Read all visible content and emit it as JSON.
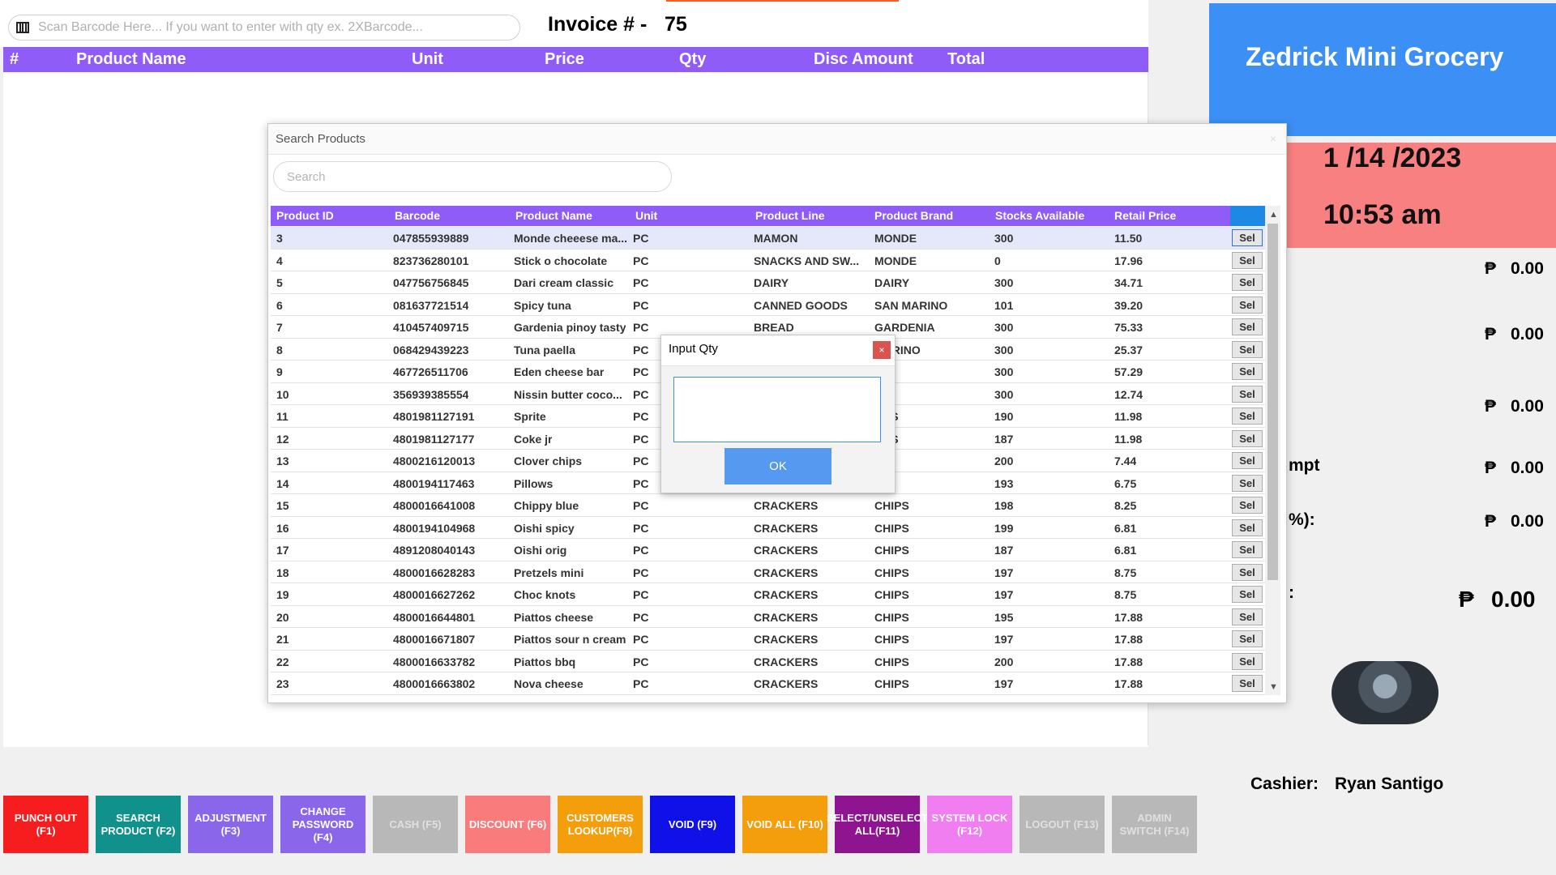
{
  "topbar": {
    "scan_placeholder": "Scan Barcode Here... If you want to enter with qty ex. 2XBarcode...",
    "invoice_label": "Invoice # -",
    "invoice_number": "75"
  },
  "invoice_table": {
    "columns": [
      "#",
      "Product Name",
      "Unit",
      "Price",
      "Qty",
      "Disc Amount",
      "Total"
    ]
  },
  "store": {
    "name": "Zedrick Mini Grocery",
    "date": "1 /14 /2023",
    "time": "10:53 am",
    "date_fragment": ":",
    "time_fragment": ":"
  },
  "summary": {
    "rows": [
      {
        "label_fragment": "",
        "currency": "₱",
        "value": "0.00"
      },
      {
        "label_fragment": "",
        "currency": "₱",
        "value": "0.00"
      },
      {
        "label_fragment": "",
        "currency": "₱",
        "value": "0.00"
      },
      {
        "label_fragment": "mpt",
        "currency": "₱",
        "value": "0.00"
      },
      {
        "label_fragment": "%):",
        "currency": "₱",
        "value": "0.00"
      },
      {
        "label_fragment": ":",
        "currency": "₱",
        "value": "0.00"
      }
    ]
  },
  "cashier": {
    "label": "Cashier:",
    "name": "Ryan Santigo"
  },
  "function_buttons": [
    {
      "label": "PUNCH OUT (F1)",
      "color": "#f51d1d",
      "text_color": "#ffffff"
    },
    {
      "label": "SEARCH PRODUCT (F2)",
      "color": "#11918c",
      "text_color": "#ffffff"
    },
    {
      "label": "ADJUSTMENT (F3)",
      "color": "#8a66ea",
      "text_color": "#ffffff"
    },
    {
      "label": "CHANGE PASSWORD (F4)",
      "color": "#8a66ea",
      "text_color": "#ffffff"
    },
    {
      "label": "CASH (F5)",
      "color": "#b8b8b8",
      "text_color": "#e0e0e0"
    },
    {
      "label": "DISCOUNT (F6)",
      "color": "#f97b7b",
      "text_color": "#ffffff"
    },
    {
      "label": "CUSTOMERS LOOKUP(F8)",
      "color": "#f59e0b",
      "text_color": "#ffffff"
    },
    {
      "label": "VOID (F9)",
      "color": "#1010e8",
      "text_color": "#ffffff"
    },
    {
      "label": "VOID ALL (F10)",
      "color": "#f59e0b",
      "text_color": "#ffffff"
    },
    {
      "label": "SELECT/UNSELECT ALL(F11)",
      "color": "#8e1490",
      "text_color": "#ffffff"
    },
    {
      "label": "SYSTEM LOCK (F12)",
      "color": "#f17ef1",
      "text_color": "#ffffff"
    },
    {
      "label": "LOGOUT (F13)",
      "color": "#b8b8b8",
      "text_color": "#e0e0e0"
    },
    {
      "label": "ADMIN SWITCH (F14)",
      "color": "#b8b8b8",
      "text_color": "#e0e0e0"
    }
  ],
  "search_dialog": {
    "title": "Search Products",
    "close": "×",
    "search_placeholder": "Search",
    "columns": [
      "Product ID",
      "Barcode",
      "Product Name",
      "Unit",
      "Product Line",
      "Product Brand",
      "Stocks Available",
      "Retail Price"
    ],
    "select_label": "Sel",
    "rows": [
      {
        "id": "3",
        "barcode": "047855939889",
        "name": "Monde cheeese ma...",
        "unit": "PC",
        "line": "MAMON",
        "brand": "MONDE",
        "stock": "300",
        "price": "11.50"
      },
      {
        "id": "4",
        "barcode": "823736280101",
        "name": "Stick o chocolate",
        "unit": "PC",
        "line": "SNACKS AND SW...",
        "brand": "MONDE",
        "stock": "0",
        "price": "17.96"
      },
      {
        "id": "5",
        "barcode": "047756756845",
        "name": "Dari cream classic",
        "unit": "PC",
        "line": "DAIRY",
        "brand": "DAIRY",
        "stock": "300",
        "price": "34.71"
      },
      {
        "id": "6",
        "barcode": "081637721514",
        "name": "Spicy tuna",
        "unit": "PC",
        "line": "CANNED GOODS",
        "brand": "SAN MARINO",
        "stock": "101",
        "price": "39.20"
      },
      {
        "id": "7",
        "barcode": "410457409715",
        "name": "Gardenia pinoy tasty",
        "unit": "PC",
        "line": "BREAD",
        "brand": "GARDENIA",
        "stock": "300",
        "price": "75.33"
      },
      {
        "id": "8",
        "barcode": "068429439223",
        "name": "Tuna paella",
        "unit": "PC",
        "line": "",
        "brand": "MARINO",
        "stock": "300",
        "price": "25.37"
      },
      {
        "id": "9",
        "barcode": "467726511706",
        "name": "Eden cheese bar",
        "unit": "PC",
        "line": "",
        "brand": "N",
        "stock": "300",
        "price": "57.29"
      },
      {
        "id": "10",
        "barcode": "356939385554",
        "name": "Nissin butter coco...",
        "unit": "PC",
        "line": "",
        "brand": "SIN",
        "stock": "300",
        "price": "12.74"
      },
      {
        "id": "11",
        "barcode": "4801981127191",
        "name": "Sprite",
        "unit": "PC",
        "line": "",
        "brand": "NKS",
        "stock": "190",
        "price": "11.98"
      },
      {
        "id": "12",
        "barcode": "4801981127177",
        "name": "Coke jr",
        "unit": "PC",
        "line": "",
        "brand": "NKS",
        "stock": "187",
        "price": "11.98"
      },
      {
        "id": "13",
        "barcode": "4800216120013",
        "name": "Clover chips",
        "unit": "PC",
        "line": "",
        "brand": "PS",
        "stock": "200",
        "price": "7.44"
      },
      {
        "id": "14",
        "barcode": "4800194117463",
        "name": "Pillows",
        "unit": "PC",
        "line": "",
        "brand": "PS",
        "stock": "193",
        "price": "6.75"
      },
      {
        "id": "15",
        "barcode": "4800016641008",
        "name": "Chippy blue",
        "unit": "PC",
        "line": "CRACKERS",
        "brand": "CHIPS",
        "stock": "198",
        "price": "8.25"
      },
      {
        "id": "16",
        "barcode": "4800194104968",
        "name": "Oishi spicy",
        "unit": "PC",
        "line": "CRACKERS",
        "brand": "CHIPS",
        "stock": "199",
        "price": "6.81"
      },
      {
        "id": "17",
        "barcode": "4891208040143",
        "name": "Oishi orig",
        "unit": "PC",
        "line": "CRACKERS",
        "brand": "CHIPS",
        "stock": "187",
        "price": "6.81"
      },
      {
        "id": "18",
        "barcode": "4800016628283",
        "name": "Pretzels mini",
        "unit": "PC",
        "line": "CRACKERS",
        "brand": "CHIPS",
        "stock": "197",
        "price": "8.75"
      },
      {
        "id": "19",
        "barcode": "4800016627262",
        "name": "Choc knots",
        "unit": "PC",
        "line": "CRACKERS",
        "brand": "CHIPS",
        "stock": "197",
        "price": "8.75"
      },
      {
        "id": "20",
        "barcode": "4800016644801",
        "name": "Piattos cheese",
        "unit": "PC",
        "line": "CRACKERS",
        "brand": "CHIPS",
        "stock": "195",
        "price": "17.88"
      },
      {
        "id": "21",
        "barcode": "4800016671807",
        "name": "Piattos sour n cream",
        "unit": "PC",
        "line": "CRACKERS",
        "brand": "CHIPS",
        "stock": "197",
        "price": "17.88"
      },
      {
        "id": "22",
        "barcode": "4800016633782",
        "name": "Piattos bbq",
        "unit": "PC",
        "line": "CRACKERS",
        "brand": "CHIPS",
        "stock": "200",
        "price": "17.88"
      },
      {
        "id": "23",
        "barcode": "4800016663802",
        "name": "Nova cheese",
        "unit": "PC",
        "line": "CRACKERS",
        "brand": "CHIPS",
        "stock": "197",
        "price": "17.88"
      }
    ]
  },
  "qty_dialog": {
    "title": "Input Qty",
    "close": "×",
    "ok_label": "OK",
    "value": ""
  },
  "colors": {
    "header_purple": "#8f5cf7",
    "store_blue": "#3b8ff5",
    "date_pink": "#f98080",
    "ok_blue": "#5599f0"
  }
}
